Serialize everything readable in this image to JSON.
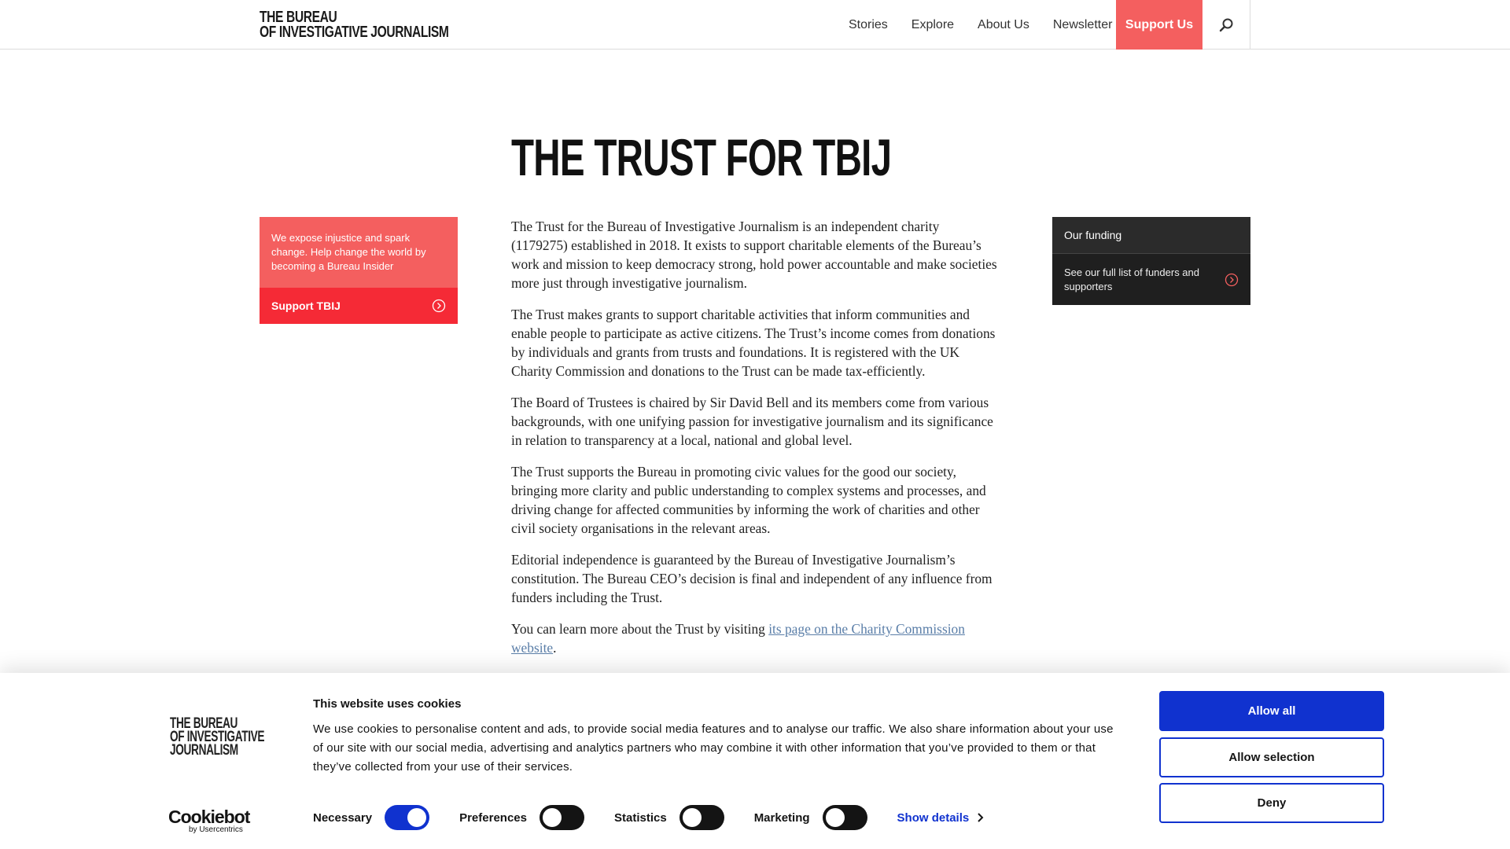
{
  "header": {
    "logo_line1": "THE BUREAU",
    "logo_line2": "OF INVESTIGATIVE JOURNALISM",
    "nav": [
      "Stories",
      "Explore",
      "About Us",
      "Newsletter"
    ],
    "support_label": "Support Us",
    "search_icon": "search-icon"
  },
  "page": {
    "title": "THE TRUST FOR TBIJ"
  },
  "promo": {
    "text": "We expose injustice and spark change. Help change the world by becoming a Bureau Insider",
    "button_label": "Support TBIJ",
    "button_icon": "circle-chevron-right-icon"
  },
  "funding": {
    "heading": "Our funding",
    "link_label": "See our full list of funders and supporters",
    "link_icon": "circle-chevron-right-icon"
  },
  "article": {
    "p1": "The Trust for the Bureau of Investigative Journalism is an independent charity (1179275) established in 2018. It exists to support charitable elements of the Bureau’s work and mission to keep democracy strong, hold power accountable and make societies more just through investigative journalism.",
    "p2": "The Trust makes grants to support charitable activities that inform communities and enable people to participate as active citizens. The Trust’s income comes from donations by individuals and grants from trusts and foundations. It is registered with the UK Charity Commission and donations to the Trust can be made tax-efficiently.",
    "p3": "The Board of Trustees is chaired by Sir David Bell and its members come from various backgrounds, with one unifying passion for investigative journalism and its significance in relation to transparency at a local, national and global level.",
    "p4": "The Trust supports the Bureau in promoting civic values for the good our society, bringing more clarity and public understanding to complex systems and processes, and driving change for affected communities by informing the work of charities and other civil society organisations in the relevant areas.",
    "p5": "Editorial independence is guaranteed by the Bureau of Investigative Journalism’s constitution. The Bureau CEO’s decision is final and independent of any influence from funders including the Trust.",
    "p6_prefix": "You can learn more about the Trust by visiting ",
    "p6_link": "its page on the Charity Commission website",
    "p6_suffix": "."
  },
  "cookie": {
    "logo_line1": "THE BUREAU",
    "logo_line2": "OF INVESTIGATIVE",
    "logo_line3": "JOURNALISM",
    "brand": "Cookiebot",
    "brand_sub": "by Usercentrics",
    "title": "This website uses cookies",
    "text": "We use cookies to personalise content and ads, to provide social media features and to analyse our traffic. We also share information about your use of our site with our social media, advertising and analytics partners who may combine it with other information that you’ve provided to them or that they’ve collected from your use of their services.",
    "toggles": [
      {
        "label": "Necessary",
        "on": true
      },
      {
        "label": "Preferences",
        "on": false
      },
      {
        "label": "Statistics",
        "on": false
      },
      {
        "label": "Marketing",
        "on": false
      }
    ],
    "show_details": "Show details",
    "allow_all": "Allow all",
    "allow_selection": "Allow selection",
    "deny": "Deny",
    "accent": "#1032cf"
  },
  "colors": {
    "support_bg": "#f45f5f",
    "promo_button_bg": "#f52a36",
    "funding_bg": "#2b2b2b",
    "link": "#5a7ea8"
  }
}
